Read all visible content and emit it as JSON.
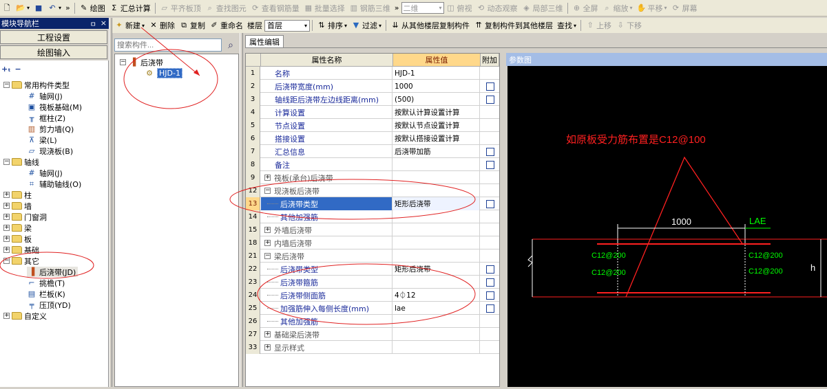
{
  "top_toolbar": {
    "draw": "绘图",
    "sum_calc": "汇总计算",
    "align_top": "平齐板顶",
    "find_elem": "查找图元",
    "view_rebar": "查看钢筋量",
    "batch_select": "批量选择",
    "rebar_3d": "钢筋三维",
    "view_mode": "二维",
    "top_view": "俯视",
    "dynamic_view": "动态观察",
    "local_3d": "局部三维",
    "fullscreen": "全屏",
    "zoom": "缩放",
    "pan": "平移",
    "screen": "屏幕"
  },
  "second_toolbar": {
    "new": "新建",
    "delete": "删除",
    "copy": "复制",
    "rename": "重命名",
    "floor_label": "楼层",
    "floor_value": "首层",
    "sort": "排序",
    "filter": "过滤",
    "copy_from_floor": "从其他楼层复制构件",
    "copy_to_floor": "复制构件到其他楼层",
    "find": "查找",
    "move_up": "上移",
    "move_down": "下移"
  },
  "nav": {
    "title": "模块导航栏",
    "pin_label": "ㅁ",
    "close_label": "×",
    "project_settings": "工程设置",
    "drawing_input": "绘图输入",
    "tree": [
      {
        "label": "常用构件类型",
        "type": "folder",
        "expanded": true
      },
      {
        "label": "轴网(J)",
        "type": "item"
      },
      {
        "label": "筏板基础(M)",
        "type": "item"
      },
      {
        "label": "框柱(Z)",
        "type": "item"
      },
      {
        "label": "剪力墙(Q)",
        "type": "item"
      },
      {
        "label": "梁(L)",
        "type": "item"
      },
      {
        "label": "现浇板(B)",
        "type": "item"
      },
      {
        "label": "轴线",
        "type": "folder",
        "expanded": true
      },
      {
        "label": "轴网(J)",
        "type": "item"
      },
      {
        "label": "辅助轴线(O)",
        "type": "item"
      },
      {
        "label": "柱",
        "type": "folder",
        "expanded": false
      },
      {
        "label": "墙",
        "type": "folder",
        "expanded": false
      },
      {
        "label": "门窗洞",
        "type": "folder",
        "expanded": false
      },
      {
        "label": "梁",
        "type": "folder",
        "expanded": false
      },
      {
        "label": "板",
        "type": "folder",
        "expanded": false
      },
      {
        "label": "基础",
        "type": "folder",
        "expanded": false
      },
      {
        "label": "其它",
        "type": "folder",
        "expanded": true
      },
      {
        "label": "后浇带(JD)",
        "type": "item",
        "selected": true
      },
      {
        "label": "挑檐(T)",
        "type": "item"
      },
      {
        "label": "栏板(K)",
        "type": "item"
      },
      {
        "label": "压顶(YD)",
        "type": "item"
      },
      {
        "label": "自定义",
        "type": "folder",
        "expanded": false
      }
    ]
  },
  "component_tree": {
    "search_placeholder": "搜索构件...",
    "root": "后浇带",
    "child": "HJD-1"
  },
  "property_editor": {
    "tab": "属性编辑",
    "col_num": "",
    "col_name": "属性名称",
    "col_value": "属性值",
    "col_add": "附加",
    "rows": [
      {
        "n": "1",
        "name": "名称",
        "value": "HJD-1",
        "check": false,
        "kind": "prop"
      },
      {
        "n": "2",
        "name": "后浇带宽度(mm)",
        "value": "1000",
        "check": true,
        "kind": "prop"
      },
      {
        "n": "3",
        "name": "轴线距后浇带左边线距离(mm)",
        "value": "(500)",
        "check": true,
        "kind": "prop"
      },
      {
        "n": "4",
        "name": "计算设置",
        "value": "按默认计算设置计算",
        "check": false,
        "kind": "prop"
      },
      {
        "n": "5",
        "name": "节点设置",
        "value": "按默认节点设置计算",
        "check": false,
        "kind": "prop"
      },
      {
        "n": "6",
        "name": "搭接设置",
        "value": "按默认搭接设置计算",
        "check": false,
        "kind": "prop"
      },
      {
        "n": "7",
        "name": "汇总信息",
        "value": "后浇带加筋",
        "check": true,
        "kind": "prop"
      },
      {
        "n": "8",
        "name": "备注",
        "value": "",
        "check": true,
        "kind": "prop"
      },
      {
        "n": "9",
        "name": "筏板(承台)后浇带",
        "value": "",
        "check": false,
        "kind": "group",
        "sign": "+"
      },
      {
        "n": "12",
        "name": "现浇板后浇带",
        "value": "",
        "check": false,
        "kind": "group",
        "sign": "-"
      },
      {
        "n": "13",
        "name": "后浇带类型",
        "value": "矩形后浇带",
        "check": true,
        "kind": "child",
        "selected": true
      },
      {
        "n": "14",
        "name": "其他加强筋",
        "value": "",
        "check": false,
        "kind": "child"
      },
      {
        "n": "15",
        "name": "外墙后浇带",
        "value": "",
        "check": false,
        "kind": "group",
        "sign": "+"
      },
      {
        "n": "18",
        "name": "内墙后浇带",
        "value": "",
        "check": false,
        "kind": "group",
        "sign": "+"
      },
      {
        "n": "21",
        "name": "梁后浇带",
        "value": "",
        "check": false,
        "kind": "group",
        "sign": "-"
      },
      {
        "n": "22",
        "name": "后浇带类型",
        "value": "矩形后浇带",
        "check": true,
        "kind": "child"
      },
      {
        "n": "23",
        "name": "后浇带箍筋",
        "value": "",
        "check": true,
        "kind": "child"
      },
      {
        "n": "24",
        "name": "后浇带侧面筋",
        "value": "4⏀12",
        "check": true,
        "kind": "child"
      },
      {
        "n": "25",
        "name": "加强筋伸入每侧长度(mm)",
        "value": "lae",
        "check": true,
        "kind": "child"
      },
      {
        "n": "26",
        "name": "其他加强筋",
        "value": "",
        "check": false,
        "kind": "child"
      },
      {
        "n": "27",
        "name": "基础梁后浇带",
        "value": "",
        "check": false,
        "kind": "group",
        "sign": "+"
      },
      {
        "n": "33",
        "name": "显示样式",
        "value": "",
        "check": false,
        "kind": "group",
        "sign": "+"
      }
    ]
  },
  "reference": {
    "title": "参数图",
    "annotation": "如原板受力筋布置是C12@100",
    "width_dim": "1000",
    "lae": "LAE",
    "bar_tl": "C12@200",
    "bar_bl": "C12@200",
    "bar_tr": "C12@200",
    "bar_br": "C12@200",
    "height": "h"
  },
  "colors": {
    "title_bar": "#0a246a",
    "selection": "#316ac5",
    "annotation_red": "#ff0000",
    "drawing_green": "#00ff00",
    "prop_name_blue": "#1a2a9a"
  }
}
